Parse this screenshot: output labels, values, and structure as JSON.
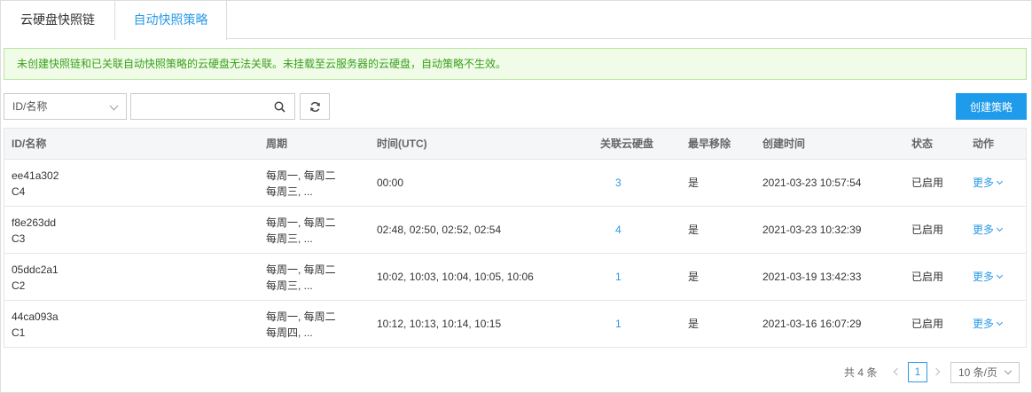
{
  "tabs": [
    {
      "label": "云硬盘快照链"
    },
    {
      "label": "自动快照策略"
    }
  ],
  "alert": {
    "text": "未创建快照链和已关联自动快照策略的云硬盘无法关联。未挂载至云服务器的云硬盘，自动策略不生效。"
  },
  "toolbar": {
    "filter_select": "ID/名称",
    "search_value": "",
    "create_label": "创建策略"
  },
  "table": {
    "columns": [
      "ID/名称",
      "周期",
      "时间(UTC)",
      "关联云硬盘",
      "最早移除",
      "创建时间",
      "状态",
      "动作"
    ],
    "rows": [
      {
        "id": "ee41a302",
        "name": "C4",
        "period1": "每周一, 每周二",
        "period2": "每周三, ...",
        "time": "00:00",
        "disks": "3",
        "remove": "是",
        "created": "2021-03-23 10:57:54",
        "status": "已启用",
        "action": "更多"
      },
      {
        "id": "f8e263dd",
        "name": "C3",
        "period1": "每周一, 每周二",
        "period2": "每周三, ...",
        "time": "02:48, 02:50, 02:52, 02:54",
        "disks": "4",
        "remove": "是",
        "created": "2021-03-23 10:32:39",
        "status": "已启用",
        "action": "更多"
      },
      {
        "id": "05ddc2a1",
        "name": "C2",
        "period1": "每周一, 每周二",
        "period2": "每周三, ...",
        "time": "10:02, 10:03, 10:04, 10:05, 10:06",
        "disks": "1",
        "remove": "是",
        "created": "2021-03-19 13:42:33",
        "status": "已启用",
        "action": "更多"
      },
      {
        "id": "44ca093a",
        "name": "C1",
        "period1": "每周一, 每周二",
        "period2": "每周四, ...",
        "time": "10:12, 10:13, 10:14, 10:15",
        "disks": "1",
        "remove": "是",
        "created": "2021-03-16 16:07:29",
        "status": "已启用",
        "action": "更多"
      }
    ]
  },
  "pagination": {
    "total_text": "共 4 条",
    "current_page": "1",
    "page_size": "10 条/页"
  },
  "icons": {
    "search": "search-icon",
    "refresh": "refresh-icon",
    "chevron": "chevron-down-icon"
  },
  "colors": {
    "accent": "#1e9bea",
    "link": "#2a9ae6",
    "alert_bg": "#f0fbe8",
    "alert_text": "#3aa11c"
  }
}
